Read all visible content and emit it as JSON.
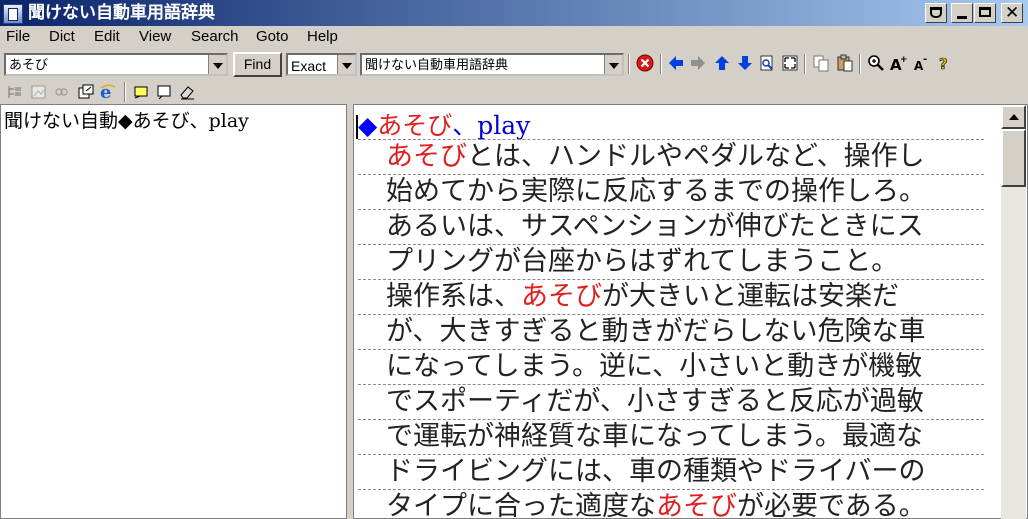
{
  "window": {
    "title": "聞けない自動車用語辞典"
  },
  "menu": [
    "File",
    "Dict",
    "Edit",
    "View",
    "Search",
    "Goto",
    "Help"
  ],
  "toolbar": {
    "search_value": "あそび",
    "find_label": "Find",
    "match_mode": "Exact",
    "dictionary": "聞けない自動車用語辞典"
  },
  "results": {
    "items": [
      "聞けない自動◆あそび、play"
    ]
  },
  "entry": {
    "marker": "◆",
    "headword": "あそび",
    "separator": "、",
    "english": "play",
    "lines": [
      [
        "",
        "あそび",
        "とは、ハンドルやペダルなど、操作し"
      ],
      [
        "始めてから実際に反応するまでの操作しろ。",
        "",
        ""
      ],
      [
        "あるいは、サスペンションが伸びたときにス",
        "",
        ""
      ],
      [
        "プリングが台座からはずれてしまうこと。",
        "",
        ""
      ],
      [
        "操作系は、",
        "あそび",
        "が大きいと運転は安楽だ"
      ],
      [
        "が、大きすぎると動きがだらしない危険な車",
        "",
        ""
      ],
      [
        "になってしまう。逆に、小さいと動きが機敏",
        "",
        ""
      ],
      [
        "でスポーティだが、小さすぎると反応が過敏",
        "",
        ""
      ],
      [
        "で運転が神経質な車になってしまう。最適な",
        "",
        ""
      ],
      [
        "ドライビングには、車の種類やドライバーの",
        "",
        ""
      ],
      [
        "タイプに合った適度な",
        "あそび",
        "が必要である。"
      ]
    ]
  },
  "colors": {
    "title_start": "#0a246a",
    "title_end": "#a6caf0",
    "highlight": "#e02020",
    "english": "#0000d0",
    "marker": "#0000ff"
  }
}
